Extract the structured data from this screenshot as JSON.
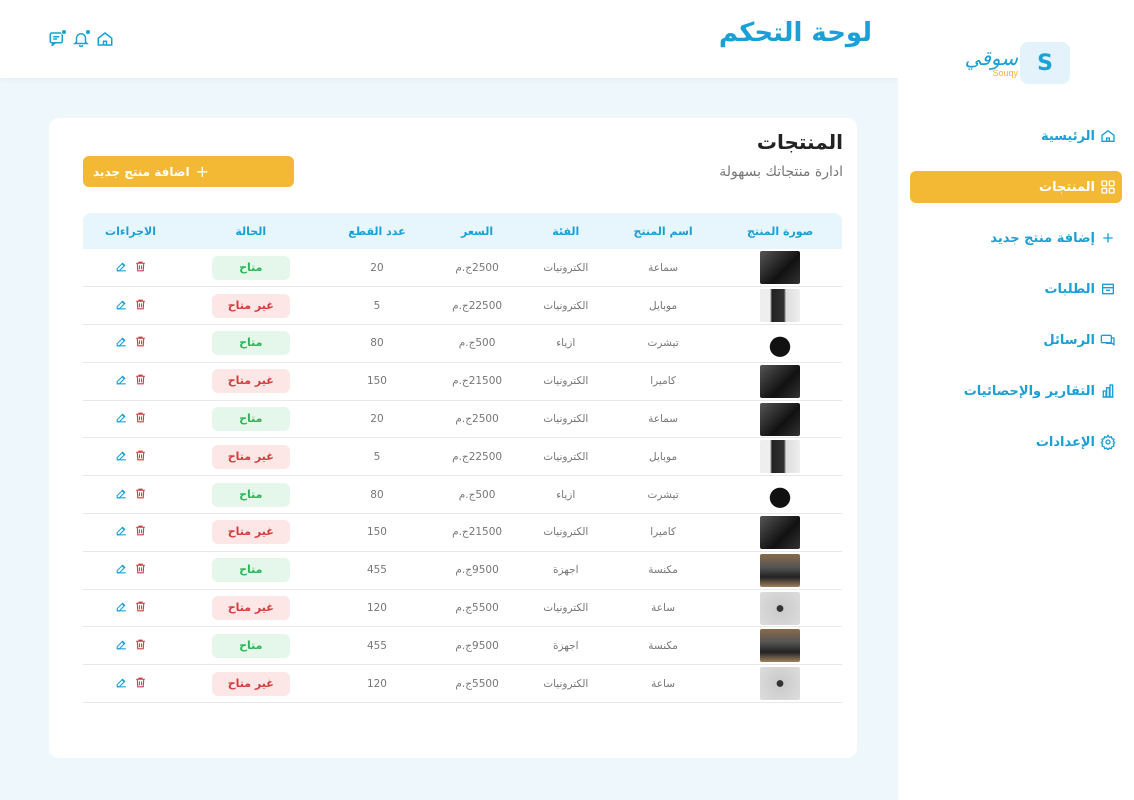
{
  "app": {
    "logo_letter": "S",
    "logo_script": "سوقي",
    "logo_sub": "Souqy"
  },
  "header": {
    "title": "لوحة التحكم"
  },
  "sidebar": {
    "items": [
      {
        "label": "الرئيسية",
        "icon": "home-icon"
      },
      {
        "label": "المنتجات",
        "icon": "grid-icon",
        "active": true
      },
      {
        "label": "إضافة منتج جديد",
        "icon": "plus-icon"
      },
      {
        "label": "الطلبات",
        "icon": "cart-icon"
      },
      {
        "label": "الرسائل",
        "icon": "chat-icon"
      },
      {
        "label": "التقارير والإحصائيات",
        "icon": "chart-icon"
      },
      {
        "label": "الإعدادات",
        "icon": "gear-icon"
      }
    ]
  },
  "products": {
    "title": "المنتجات",
    "subtitle": "ادارة منتجاتك بسهولة",
    "add_button": "اضافة منتج جديد",
    "columns": [
      "صورة المنتج",
      "اسم المنتج",
      "الفئة",
      "السعر",
      "عدد القطع",
      "الحالة",
      "الاجراءات"
    ],
    "rows": [
      {
        "img": "dark",
        "name": "سماعة",
        "category": "الكترونيات",
        "price": "2500ج.م",
        "qty": "20",
        "status": "متاح",
        "ok": true
      },
      {
        "img": "phone",
        "name": "موبايل",
        "category": "الكترونيات",
        "price": "22500ج.م",
        "qty": "5",
        "status": "غير متاح",
        "ok": false
      },
      {
        "img": "shirt",
        "name": "تيشرت",
        "category": "ازياء",
        "price": "500ج.م",
        "qty": "80",
        "status": "متاح",
        "ok": true
      },
      {
        "img": "dark",
        "name": "كاميرا",
        "category": "الكترونيات",
        "price": "21500ج.م",
        "qty": "150",
        "status": "غير متاح",
        "ok": false
      },
      {
        "img": "dark",
        "name": "سماعة",
        "category": "الكترونيات",
        "price": "2500ج.م",
        "qty": "20",
        "status": "متاح",
        "ok": true
      },
      {
        "img": "phone",
        "name": "موبايل",
        "category": "الكترونيات",
        "price": "22500ج.م",
        "qty": "5",
        "status": "غير متاح",
        "ok": false
      },
      {
        "img": "shirt",
        "name": "تيشرت",
        "category": "ازياء",
        "price": "500ج.م",
        "qty": "80",
        "status": "متاح",
        "ok": true
      },
      {
        "img": "dark",
        "name": "كاميرا",
        "category": "الكترونيات",
        "price": "21500ج.م",
        "qty": "150",
        "status": "غير متاح",
        "ok": false
      },
      {
        "img": "vac",
        "name": "مكنسة",
        "category": "اجهزة",
        "price": "9500ج.م",
        "qty": "455",
        "status": "متاح",
        "ok": true
      },
      {
        "img": "watch",
        "name": "ساعة",
        "category": "الكترونيات",
        "price": "5500ج.م",
        "qty": "120",
        "status": "غير متاح",
        "ok": false
      },
      {
        "img": "vac",
        "name": "مكنسة",
        "category": "اجهزة",
        "price": "9500ج.م",
        "qty": "455",
        "status": "متاح",
        "ok": true
      },
      {
        "img": "watch",
        "name": "ساعة",
        "category": "الكترونيات",
        "price": "5500ج.م",
        "qty": "120",
        "status": "غير متاح",
        "ok": false
      }
    ]
  },
  "colors": {
    "accent": "#19a0d6",
    "button": "#f3b935",
    "available": "#2fb35a",
    "unavailable": "#d23c3c"
  }
}
